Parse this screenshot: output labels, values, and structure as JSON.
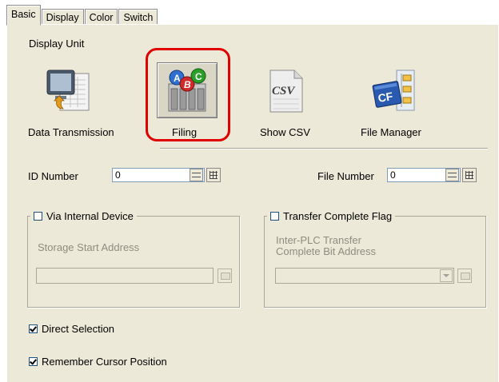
{
  "tabs": [
    "Basic",
    "Display",
    "Color",
    "Switch"
  ],
  "display_unit": {
    "heading": "Display Unit",
    "items": [
      {
        "label": "Data Transmission",
        "icon": "data-transmission-icon",
        "selected": false
      },
      {
        "label": "Filing",
        "icon": "filing-icon",
        "selected": true
      },
      {
        "label": "Show CSV",
        "icon": "csv-icon",
        "selected": false
      },
      {
        "label": "File Manager",
        "icon": "cf-file-manager-icon",
        "selected": false
      }
    ],
    "csv_icon_text": "CSV",
    "cf_icon_text": "CF"
  },
  "id_number": {
    "label": "ID Number",
    "value": "0"
  },
  "file_number": {
    "label": "File Number",
    "value": "0"
  },
  "via_internal": {
    "label": "Via Internal Device",
    "checked": false,
    "field_label": "Storage Start Address"
  },
  "transfer_complete": {
    "label": "Transfer Complete Flag",
    "checked": false,
    "field_label_1": "Inter-PLC Transfer",
    "field_label_2": "Complete Bit Address"
  },
  "direct_selection": {
    "label": "Direct Selection",
    "checked": true
  },
  "remember_cursor": {
    "label": "Remember Cursor Position",
    "checked": true
  },
  "colors": {
    "highlight": "#e00000",
    "panel": "#ece9d8"
  }
}
